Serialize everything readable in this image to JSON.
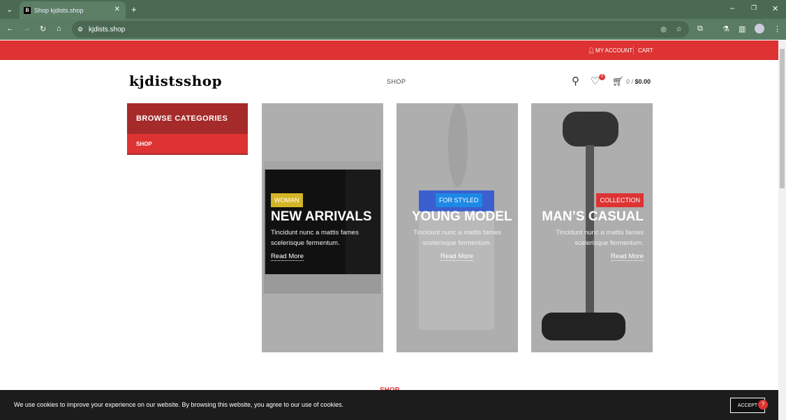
{
  "browser": {
    "tab_title": "Shop kjdists.shop",
    "favicon": "B",
    "url": "kjdists.shop"
  },
  "topbar": {
    "account": "MY ACCOUNT",
    "cart": "CART"
  },
  "header": {
    "logo": "kjdistsshop",
    "nav_shop": "SHOP",
    "wishlist_count": "0",
    "cart_count": "0 /",
    "cart_total": "$0.00"
  },
  "sidebar": {
    "title": "BROWSE CATEGORIES",
    "items": [
      {
        "label": "SHOP"
      }
    ]
  },
  "banners": [
    {
      "label": "WOMAN",
      "label_color": "#d4b528",
      "title": "NEW ARRIVALS",
      "desc": "Tincidunt nunc a mattis fames scelerisque fermentum.",
      "link": "Read More",
      "product": "microwave"
    },
    {
      "label": "FOR STYLED",
      "label_color": "#1e88e5",
      "title": "YOUNG MODEL",
      "desc": "Tincidunt nunc a mattis fames scelerisque fermentum.",
      "link": "Read More",
      "product": "humidifier"
    },
    {
      "label": "COLLECTION",
      "label_color": "#dd3333",
      "title": "MAN’S CASUAL",
      "desc": "Tincidunt nunc a mattis fames scelerisque fermentum.",
      "link": "Read More",
      "product": "vacuum"
    }
  ],
  "section_title": "SHOP",
  "cookie": {
    "text": "We use cookies to improve your experience on our website. By browsing this website, you agree to our use of cookies.",
    "accept": "ACCEPT"
  },
  "colors": {
    "accent": "#dd3333",
    "accent_dark": "#a52a2a",
    "chrome": "#5b7c64"
  }
}
